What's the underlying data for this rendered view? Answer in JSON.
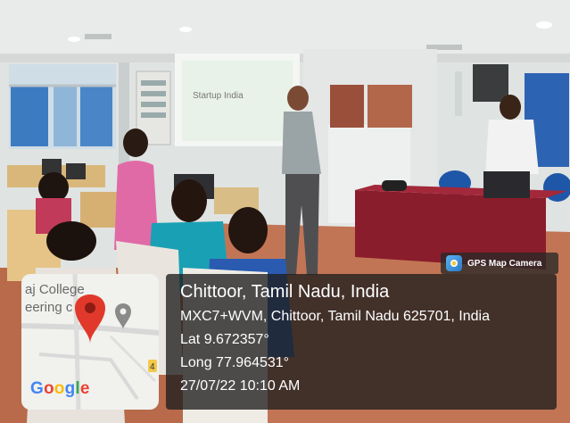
{
  "photo": {
    "slide_title": "Startup India"
  },
  "badge": {
    "label": "GPS Map Camera",
    "icon": "camera-icon"
  },
  "map_thumbnail": {
    "poi_line1": "aj College",
    "poi_line2": "eering c",
    "road_marker": "4",
    "logo": [
      "G",
      "o",
      "o",
      "g",
      "l",
      "e"
    ],
    "logo_colors": [
      "#4285F4",
      "#EA4335",
      "#FBBC05",
      "#4285F4",
      "#34A853",
      "#EA4335"
    ]
  },
  "location": {
    "title": "Chittoor, Tamil Nadu, India",
    "address": "MXC7+WVM, Chittoor, Tamil Nadu 625701, India",
    "latitude": "Lat 9.672357°",
    "longitude": "Long 77.964531°",
    "datetime": "27/07/22 10:10 AM"
  }
}
